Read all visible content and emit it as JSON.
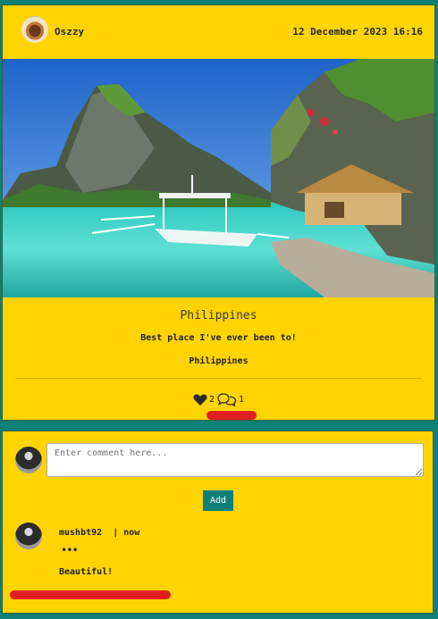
{
  "post": {
    "username": "Oszzy",
    "timestamp": "12 December 2023 16:16",
    "title": "Philippines",
    "description": "Best place I've ever been to!",
    "location": "Philippines",
    "likes": "2",
    "comments_count": "1"
  },
  "comment_form": {
    "placeholder": "Enter comment here...",
    "add_label": "Add"
  },
  "comments": [
    {
      "username": "mushbt92",
      "meta": "mushbt92  | now",
      "more": "•••",
      "text": "Beautiful!"
    }
  ],
  "colors": {
    "card": "#ffd400",
    "background": "#0e8078",
    "button": "#0e8078",
    "annotation": "#e02020"
  }
}
